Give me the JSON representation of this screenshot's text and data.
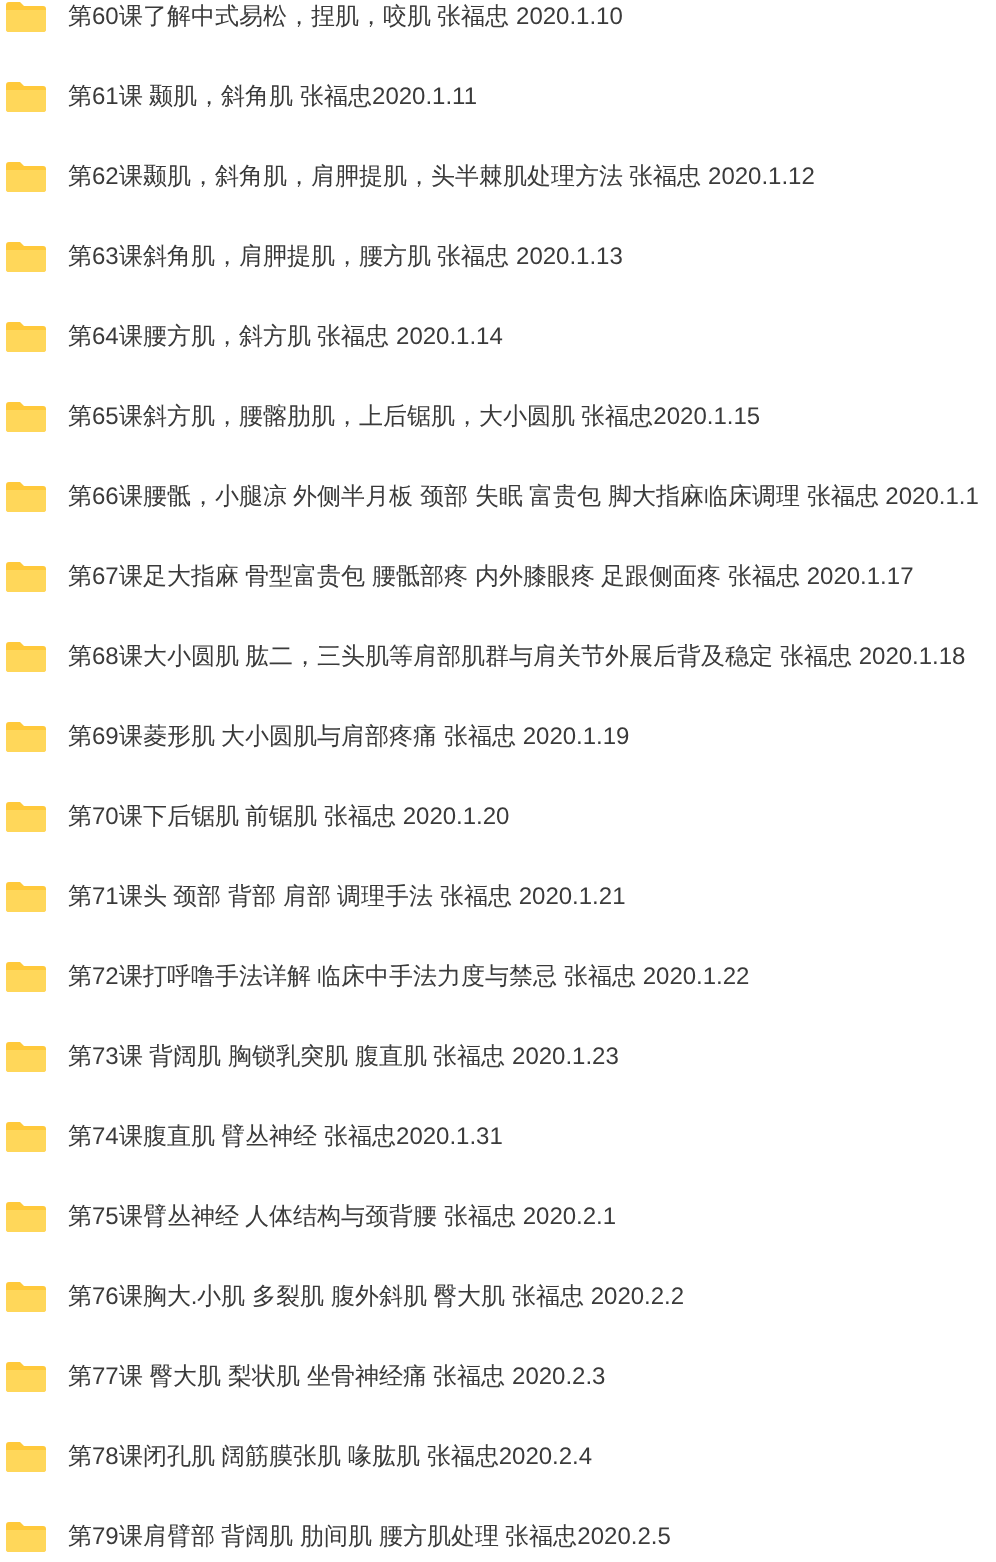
{
  "folders": [
    {
      "name": "第60课了解中式易松，捏肌，咬肌 张福忠 2020.1.10"
    },
    {
      "name": "第61课 颞肌，斜角肌 张福忠2020.1.11"
    },
    {
      "name": "第62课颞肌，斜角肌，肩胛提肌，头半棘肌处理方法 张福忠 2020.1.12"
    },
    {
      "name": "第63课斜角肌，肩胛提肌，腰方肌 张福忠 2020.1.13"
    },
    {
      "name": "第64课腰方肌，斜方肌 张福忠 2020.1.14"
    },
    {
      "name": "第65课斜方肌，腰髂肋肌，上后锯肌，大小圆肌 张福忠2020.1.15"
    },
    {
      "name": "第66课腰骶，小腿凉 外侧半月板 颈部 失眠 富贵包 脚大指麻临床调理 张福忠 2020.1.1"
    },
    {
      "name": "第67课足大指麻 骨型富贵包 腰骶部疼 内外膝眼疼 足跟侧面疼 张福忠 2020.1.17"
    },
    {
      "name": "第68课大小圆肌 肱二，三头肌等肩部肌群与肩关节外展后背及稳定 张福忠 2020.1.18"
    },
    {
      "name": "第69课菱形肌 大小圆肌与肩部疼痛 张福忠 2020.1.19"
    },
    {
      "name": "第70课下后锯肌 前锯肌 张福忠 2020.1.20"
    },
    {
      "name": "第71课头 颈部 背部 肩部 调理手法 张福忠 2020.1.21"
    },
    {
      "name": "第72课打呼噜手法详解 临床中手法力度与禁忌 张福忠 2020.1.22"
    },
    {
      "name": "第73课 背阔肌 胸锁乳突肌 腹直肌 张福忠 2020.1.23"
    },
    {
      "name": "第74课腹直肌 臂丛神经 张福忠2020.1.31"
    },
    {
      "name": "第75课臂丛神经 人体结构与颈背腰 张福忠 2020.2.1"
    },
    {
      "name": "第76课胸大.小肌 多裂肌 腹外斜肌 臀大肌 张福忠 2020.2.2"
    },
    {
      "name": "第77课 臀大肌 梨状肌 坐骨神经痛 张福忠 2020.2.3"
    },
    {
      "name": "第78课闭孔肌 阔筋膜张肌 喙肱肌 张福忠2020.2.4"
    },
    {
      "name": "第79课肩臂部 背阔肌 肋间肌 腰方肌处理 张福忠2020.2.5"
    }
  ]
}
